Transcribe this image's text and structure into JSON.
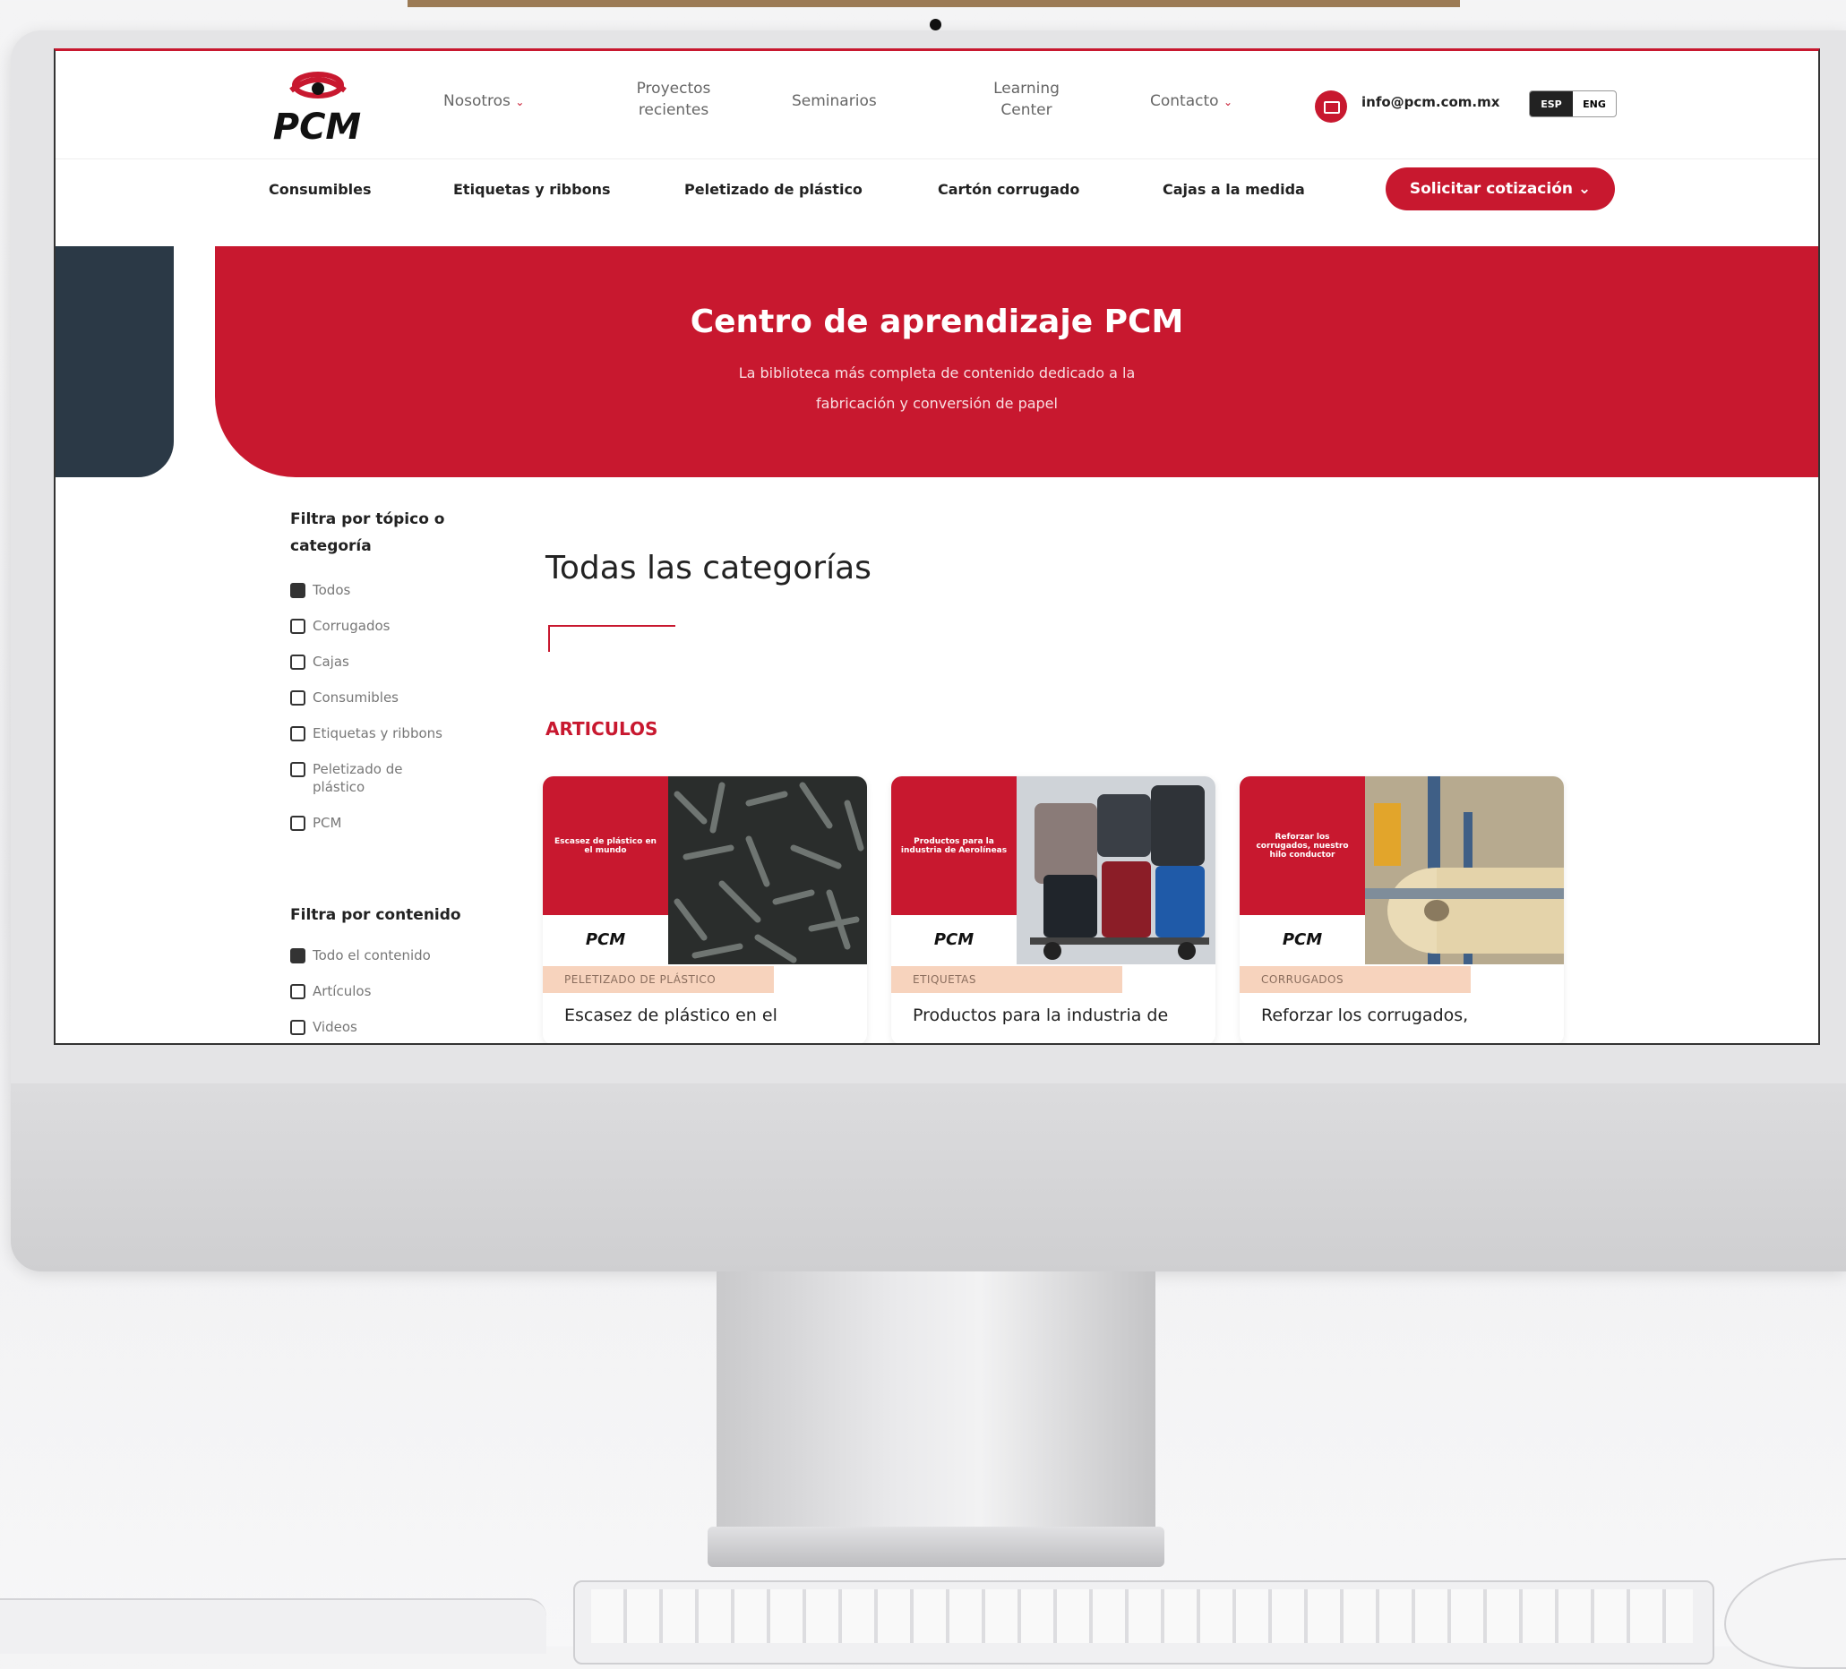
{
  "nav": {
    "items": [
      {
        "label": "Nosotros",
        "dropdown": true
      },
      {
        "label": "Proyectos\nrecientes"
      },
      {
        "label": "Seminarios"
      },
      {
        "label": "Learning\nCenter"
      },
      {
        "label": "Contacto",
        "dropdown": true
      }
    ],
    "email": "info@pcm.com.mx",
    "lang": [
      "ESP",
      "ENG"
    ],
    "lang_selected": "ESP",
    "logo_text": "PCM"
  },
  "subnav": {
    "items": [
      "Consumibles",
      "Etiquetas y ribbons",
      "Peletizado de plástico",
      "Cartón corrugado",
      "Cajas a la medida"
    ],
    "cta": "Solicitar cotización ⌄"
  },
  "hero": {
    "title": "Centro de aprendizaje PCM",
    "subtitle_line1": "La biblioteca más completa de contenido dedicado a la",
    "subtitle_line2": "fabricación y conversión de papel"
  },
  "filters": {
    "topic_title": "Filtra por tópico o\ncategoría",
    "topics": [
      {
        "label": "Todos",
        "checked": true
      },
      {
        "label": "Corrugados",
        "checked": false
      },
      {
        "label": "Cajas",
        "checked": false
      },
      {
        "label": "Consumibles",
        "checked": false
      },
      {
        "label": "Etiquetas y ribbons",
        "checked": false
      },
      {
        "label": "Peletizado de\nplástico",
        "checked": false
      },
      {
        "label": "PCM",
        "checked": false
      }
    ],
    "content_title": "Filtra por contenido",
    "contents": [
      {
        "label": "Todo el contenido",
        "checked": true
      },
      {
        "label": "Artículos",
        "checked": false
      },
      {
        "label": "Videos",
        "checked": false
      }
    ]
  },
  "main": {
    "heading": "Todas las categorías",
    "section": "ARTICULOS",
    "cards": [
      {
        "red_text": "Escasez de plástico en el mundo",
        "tag": "PELETIZADO DE PLÁSTICO",
        "title": "Escasez de plástico en el"
      },
      {
        "red_text": "Productos para la industria de Aerolíneas",
        "tag": "ETIQUETAS",
        "title": "Productos para la industria de"
      },
      {
        "red_text": "Reforzar los corrugados, nuestro hilo conductor",
        "tag": "CORRUGADOS",
        "title": "Reforzar los corrugados,"
      }
    ]
  },
  "colors": {
    "brand_red": "#c8182f",
    "navy": "#2b3946",
    "tag_bg": "#f7d3bd"
  }
}
